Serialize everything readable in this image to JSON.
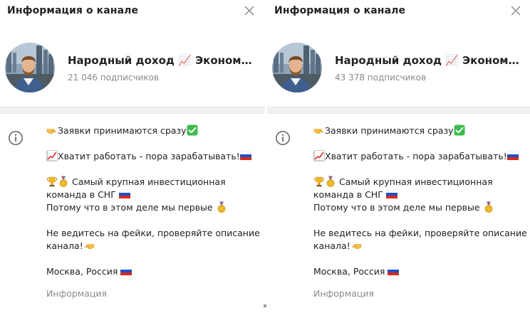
{
  "panels": [
    {
      "header_title": "Информация о канале",
      "channel_name": "Народный доход 📈 Экономич...",
      "subscribers": "21 046 подписчиков",
      "description": {
        "line1": "Заявки принимаются сразу",
        "line2": "Хватит работать - пора зарабатывать!",
        "line3": "Самый крупная инвестиционная",
        "line4": "команда в СНГ",
        "line5": "Потому что в этом деле мы первые",
        "line6": "Не ведитесь на фейки, проверяйте описание",
        "line7": "канала!",
        "line8": "Москва, Россия"
      },
      "info_label": "Информация"
    },
    {
      "header_title": "Информация о канале",
      "channel_name": "Народный доход 📈 Экономич...",
      "subscribers": "43 378 подписчиков",
      "description": {
        "line1": "Заявки принимаются сразу",
        "line2": "Хватит работать - пора зарабатывать!",
        "line3": "Самый крупная инвестиционная",
        "line4": "команда в СНГ",
        "line5": "Потому что в этом деле мы первые",
        "line6": "Не ведитесь на фейки, проверяйте описание",
        "line7": "канала!",
        "line8": "Москва, Россия"
      },
      "info_label": "Информация"
    }
  ],
  "icons": {
    "close": "close-icon",
    "info": "info-icon",
    "emoji": [
      "pointing-hand-icon",
      "check-mark-icon",
      "chart-up-icon",
      "russia-flag-icon",
      "trophy-icon",
      "medal-icon"
    ]
  },
  "colors": {
    "text": "#222222",
    "secondary_text": "#8a8a8a",
    "divider": "#f1f1f1",
    "check_green": "#3dba4e",
    "chart_red": "#e0312a"
  }
}
